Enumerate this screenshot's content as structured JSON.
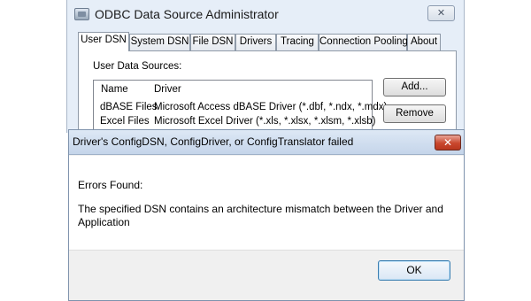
{
  "odbc_window": {
    "title": "ODBC Data Source Administrator",
    "close_glyph": "✕",
    "tabs": [
      {
        "label": "User DSN",
        "active": true
      },
      {
        "label": "System DSN",
        "active": false
      },
      {
        "label": "File DSN",
        "active": false
      },
      {
        "label": "Drivers",
        "active": false
      },
      {
        "label": "Tracing",
        "active": false
      },
      {
        "label": "Connection Pooling",
        "active": false
      },
      {
        "label": "About",
        "active": false
      }
    ],
    "section_label": "User Data Sources:",
    "list": {
      "columns": [
        "Name",
        "Driver"
      ],
      "rows": [
        {
          "name": "dBASE Files",
          "driver": "Microsoft Access dBASE Driver (*.dbf, *.ndx, *.mdx)"
        },
        {
          "name": "Excel Files",
          "driver": "Microsoft Excel Driver (*.xls, *.xlsx, *.xlsm, *.xlsb)"
        }
      ]
    },
    "buttons": {
      "add": "Add...",
      "remove": "Remove"
    }
  },
  "error_dialog": {
    "title": "Driver's ConfigDSN, ConfigDriver, or ConfigTranslator failed",
    "close_glyph": "✕",
    "heading": "Errors Found:",
    "message": "The specified DSN contains an architecture mismatch between the Driver and Application",
    "ok_label": "OK"
  },
  "colors": {
    "dialog_title_gradient": "#c5d5ea",
    "close_button_red": "#c9472d",
    "ok_button_border": "#3c7fb1"
  }
}
